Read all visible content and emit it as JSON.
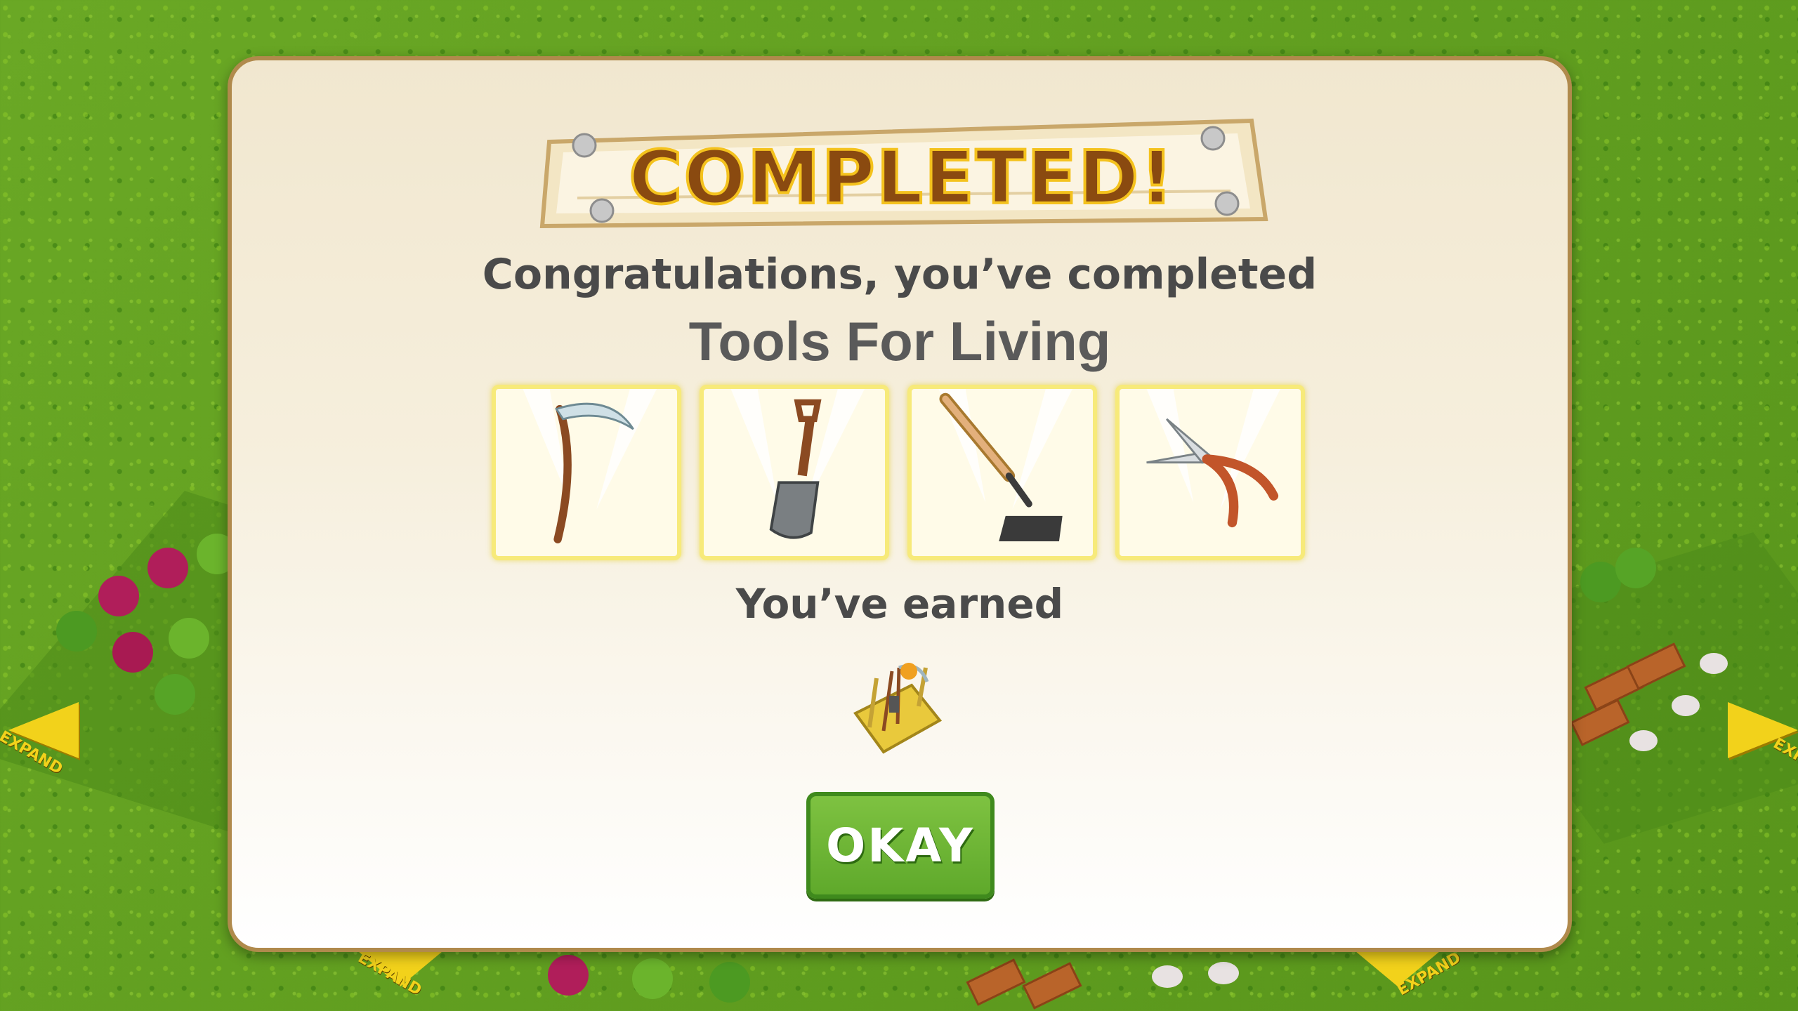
{
  "dialog": {
    "banner_text": "COMPLETED!",
    "congrats_text": "Congratulations, you’ve completed",
    "collection_name": "Tools For Living",
    "items": [
      {
        "icon": "scythe-icon"
      },
      {
        "icon": "shovel-icon"
      },
      {
        "icon": "hoe-icon"
      },
      {
        "icon": "shears-icon"
      }
    ],
    "earned_text": "You’ve earned",
    "reward_icon": "tool-rack-icon",
    "okay_label": "OKAY"
  },
  "background": {
    "expand_labels": [
      "EXPAND",
      "EXPAND",
      "EXPAND",
      "EXPAND"
    ]
  },
  "colors": {
    "dialog_border": "#b08a4c",
    "button_green": "#5fa92b",
    "banner_brown": "#8a4a10",
    "banner_gold": "#f4c21d",
    "grass": "#5f9c1f",
    "expand_arrow": "#f2d21b"
  }
}
